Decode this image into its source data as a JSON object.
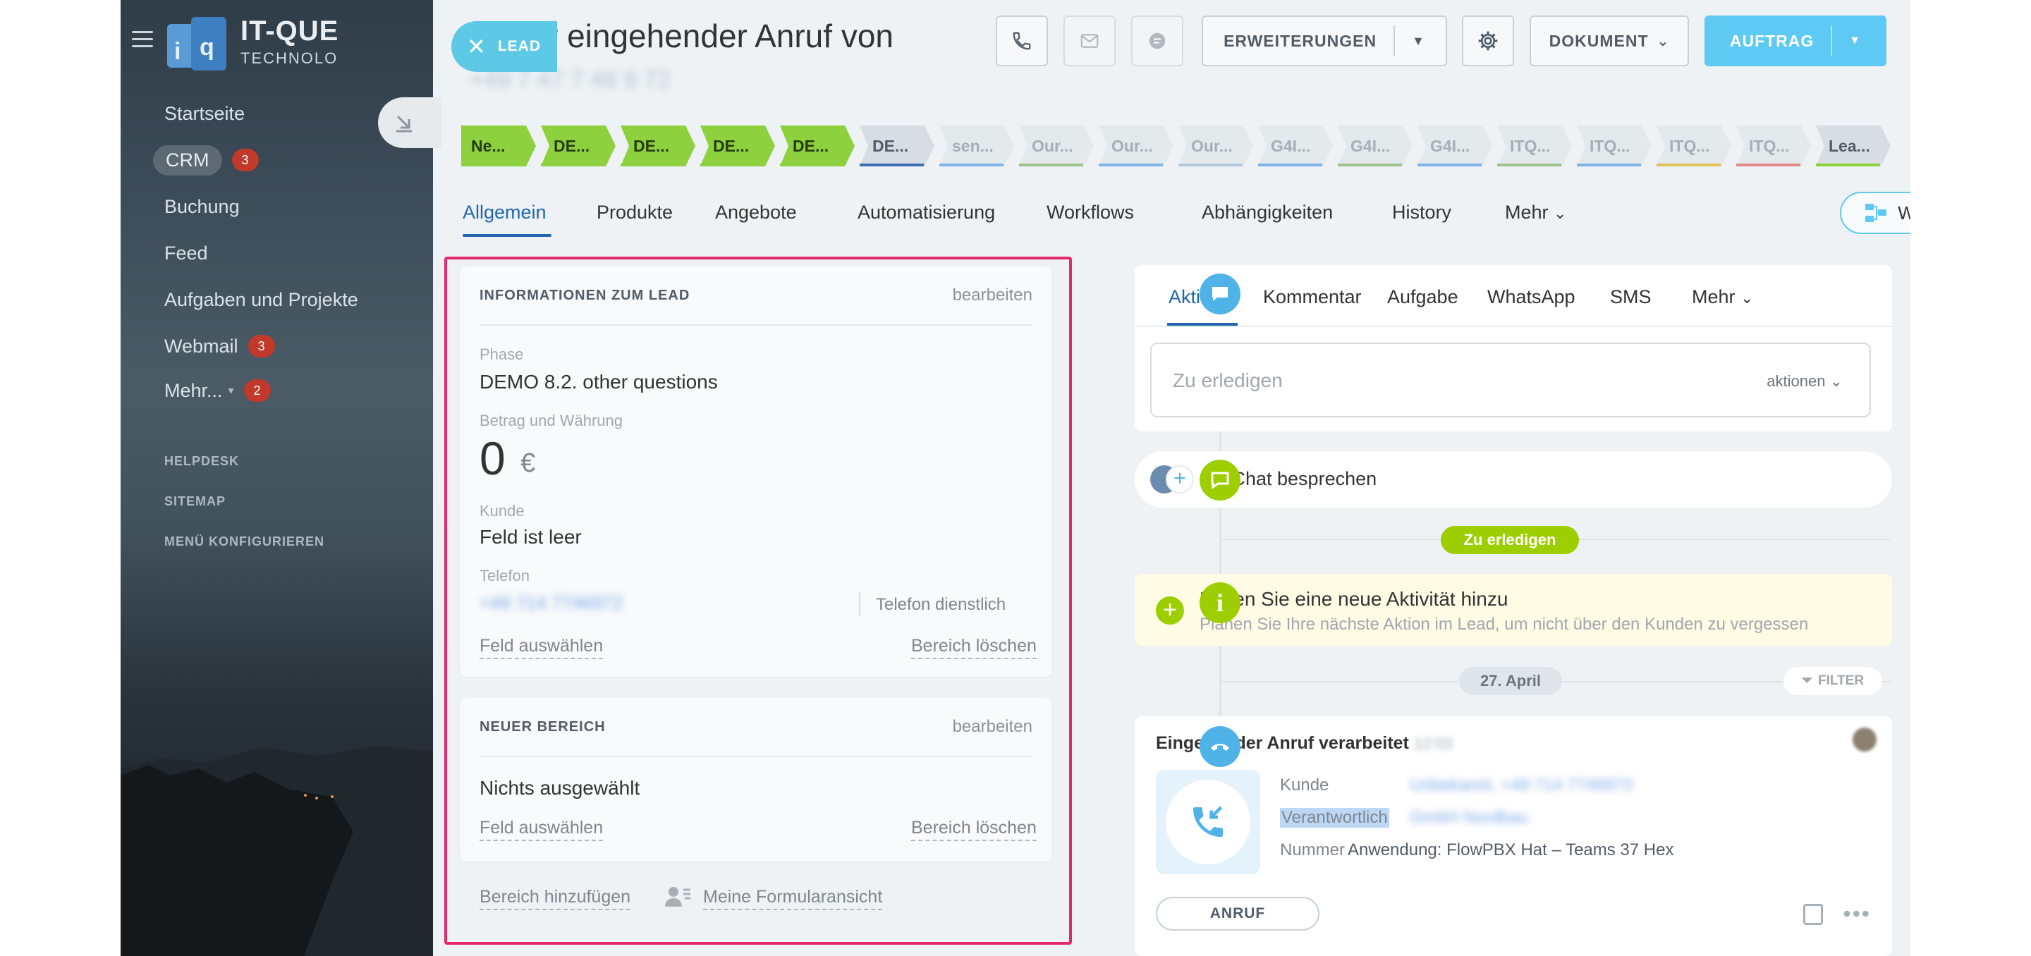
{
  "sidebar": {
    "logo_text": "IT-QUE",
    "logo_sub": "TECHNOLO",
    "items": [
      {
        "label": "Startseite",
        "badge": ""
      },
      {
        "label": "CRM",
        "badge": "3"
      },
      {
        "label": "Buchung",
        "badge": ""
      },
      {
        "label": "Feed",
        "badge": ""
      },
      {
        "label": "Aufgaben und Projekte",
        "badge": ""
      },
      {
        "label": "Webmail",
        "badge": "3"
      },
      {
        "label": "Mehr...",
        "badge": "2"
      }
    ],
    "helpdesk": "HELPDESK",
    "sitemap": "SITEMAP",
    "configure": "MENÜ KONFIGURIEREN"
  },
  "lead_tab": {
    "label": "LEAD"
  },
  "header": {
    "title": "Neuer eingehender Anruf von",
    "subtitle": "+49 7 47 7 46 9 72",
    "extensions_label": "ERWEITERUNGEN",
    "document_label": "DOKUMENT",
    "order_label": "AUFTRAG"
  },
  "stages": [
    {
      "label": "Ne...",
      "fill": "#8ed13f",
      "text": "#263b0d",
      "line": "#8ed13f"
    },
    {
      "label": "DE...",
      "fill": "#8ed13f",
      "text": "#263b0d",
      "line": "#8ed13f"
    },
    {
      "label": "DE...",
      "fill": "#8ed13f",
      "text": "#263b0d",
      "line": "#8ed13f"
    },
    {
      "label": "DE...",
      "fill": "#8ed13f",
      "text": "#263b0d",
      "line": "#8ed13f"
    },
    {
      "label": "DE...",
      "fill": "#8ed13f",
      "text": "#263b0d",
      "line": "#8ed13f"
    },
    {
      "label": "DE...",
      "fill": "#d7dde2",
      "text": "#525c69",
      "line": "#3a6fb4"
    },
    {
      "label": "sen...",
      "fill": "#e4e9ec",
      "text": "#a5aeb5",
      "line": "#7fb4e8"
    },
    {
      "label": "Our...",
      "fill": "#e4e9ec",
      "text": "#a5aeb5",
      "line": "#9cc28d"
    },
    {
      "label": "Our...",
      "fill": "#e4e9ec",
      "text": "#a5aeb5",
      "line": "#7fb4e8"
    },
    {
      "label": "Our...",
      "fill": "#e4e9ec",
      "text": "#a5aeb5",
      "line": "#b4c9de"
    },
    {
      "label": "G4I...",
      "fill": "#e4e9ec",
      "text": "#a5aeb5",
      "line": "#7fb4e8"
    },
    {
      "label": "G4I...",
      "fill": "#e4e9ec",
      "text": "#a5aeb5",
      "line": "#9cc28d"
    },
    {
      "label": "G4I...",
      "fill": "#e4e9ec",
      "text": "#a5aeb5",
      "line": "#7fb4e8"
    },
    {
      "label": "ITQ...",
      "fill": "#e4e9ec",
      "text": "#a5aeb5",
      "line": "#9cc28d"
    },
    {
      "label": "ITQ...",
      "fill": "#e4e9ec",
      "text": "#a5aeb5",
      "line": "#7fb4e8"
    },
    {
      "label": "ITQ...",
      "fill": "#e4e9ec",
      "text": "#a5aeb5",
      "line": "#e3c25c"
    },
    {
      "label": "ITQ...",
      "fill": "#e4e9ec",
      "text": "#a5aeb5",
      "line": "#e38a8a"
    },
    {
      "label": "Lea...",
      "fill": "#d7dde2",
      "text": "#525c69",
      "line": "#8ed13f"
    }
  ],
  "tabs": [
    "Allgemein",
    "Produkte",
    "Angebote",
    "Automatisierung",
    "Workflows",
    "Abhängigkeiten",
    "History",
    "Mehr"
  ],
  "workflows_button": "Workflows",
  "lead_info": {
    "title": "INFORMATIONEN ZUM LEAD",
    "edit": "bearbeiten",
    "phase_label": "Phase",
    "phase_value": "DEMO 8.2. other questions",
    "amount_label": "Betrag und Währung",
    "amount_value": "0",
    "currency": "€",
    "customer_label": "Kunde",
    "customer_value": "Feld ist leer",
    "phone_label": "Telefon",
    "phone_value": "+49 714 7746972",
    "phone_type": "Telefon dienstlich",
    "select_field": "Feld auswählen",
    "delete_section": "Bereich löschen"
  },
  "new_section": {
    "title": "NEUER BEREICH",
    "edit": "bearbeiten",
    "nothing_selected": "Nichts ausgewählt",
    "select_field": "Feld auswählen",
    "delete_section": "Bereich löschen"
  },
  "footer_links": {
    "add_section": "Bereich hinzufügen",
    "my_form_view": "Meine Formularansicht"
  },
  "activity": {
    "tabs": [
      "Aktivität",
      "Kommentar",
      "Aufgabe",
      "WhatsApp",
      "SMS",
      "Mehr"
    ],
    "todo_placeholder": "Zu erledigen",
    "actions_label": "aktionen",
    "chat_label": "Im Chat besprechen",
    "todo_pill": "Zu erledigen",
    "new_activity_title": "Fügen Sie eine neue Aktivität hinzu",
    "new_activity_sub": "Planen Sie Ihre nächste Aktion im Lead, um nicht über den Kunden zu vergessen",
    "date_pill": "27. April",
    "filter": "FILTER",
    "call_title": "Eingehender Anruf verarbeitet",
    "call_time": "12:03",
    "customer_label": "Kunde",
    "customer_value": "Unbekannt, +49 714 7746972",
    "responsible_label": "Verantwortlich",
    "responsible_value": "GmbH Nordbau",
    "number_label": "Nummer",
    "number_value": "Anwendung: FlowPBX Hat – Teams 37 Hex",
    "call_button": "ANRUF"
  },
  "colors": {
    "accent": "#2067b0",
    "stage_done": "#8ed13f",
    "primary_button": "#5ec9f3",
    "highlight": "#e5286b",
    "timeline_green": "#9dcf00"
  }
}
